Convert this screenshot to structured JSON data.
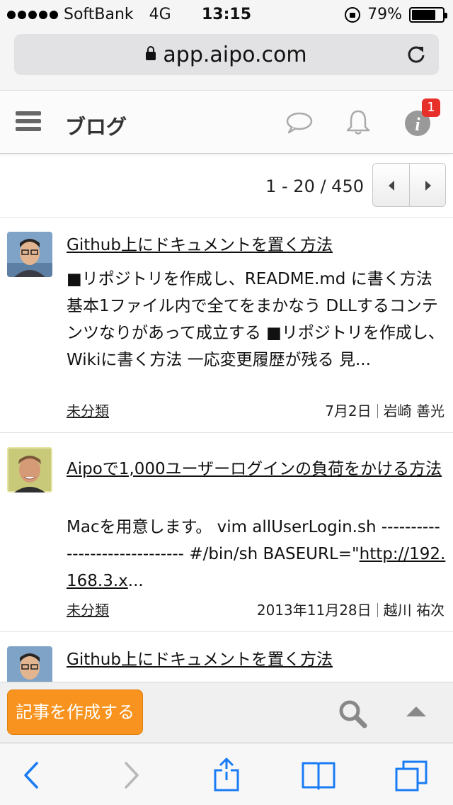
{
  "status_bar": {
    "carrier": "SoftBank",
    "network": "4G",
    "time": "13:15",
    "battery": "79%",
    "battery_level": 0.79
  },
  "browser": {
    "url": "app.aipo.com"
  },
  "header": {
    "title": "ブログ",
    "notification_badge": "1",
    "icons": [
      "menu-icon",
      "chat-icon",
      "bell-icon",
      "info-icon"
    ]
  },
  "pager": {
    "range": "1 - 20 / 450"
  },
  "posts": [
    {
      "title": "Github上にドキュメントを置く方法",
      "excerpt": "■リポジトリを作成し、README.md に書く方法 基本1ファイル内で全てをまかなう DLLするコンテンツなりがあって成立する ■リポジトリを作成し、Wikiに書く方法 一応変更履歴が残る 見...",
      "category": "未分類",
      "date": "7月2日",
      "author": "岩崎 善光"
    },
    {
      "title": "Aipoで1,000ユーザーログインの負荷をかける方法",
      "excerpt_pre": "Macを用意します。 vim allUserLogin.sh ------------------------------ #/bin/sh BASEURL=\"",
      "excerpt_link": "http://192.168.3.x",
      "excerpt_post": "...",
      "category": "未分類",
      "date": "2013年11月28日",
      "author": "越川 祐次"
    },
    {
      "title": "Github上にドキュメントを置く方法"
    }
  ],
  "toolbar": {
    "create_label": "記事を作成する",
    "accent_color": "#f7931e"
  }
}
